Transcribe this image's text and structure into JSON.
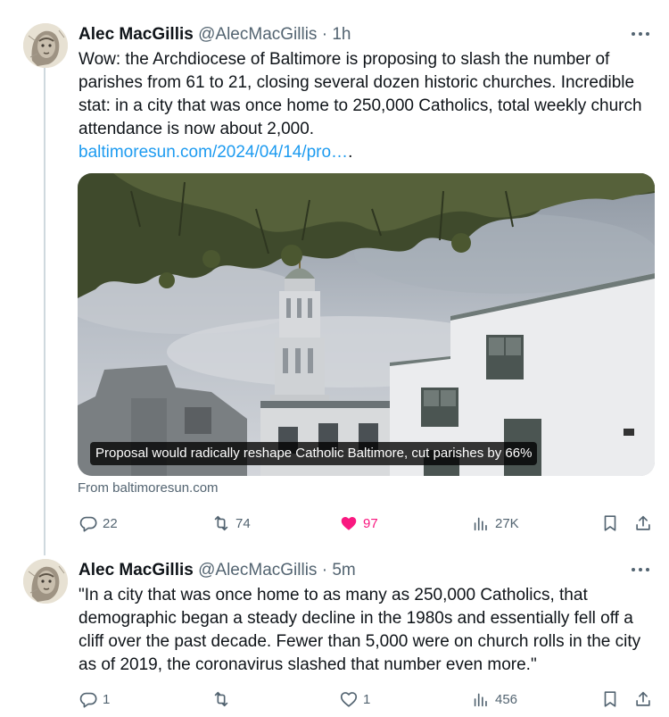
{
  "tweets": [
    {
      "name": "Alec MacGillis",
      "handle": "@AlecMacGillis",
      "separator": "·",
      "time": "1h",
      "text": "Wow: the Archdiocese of Baltimore is proposing to slash the number of parishes from 61 to 21, closing several dozen historic churches. Incredible stat: in a city that was once home to 250,000 Catholics, total weekly church attendance is now about 2,000.",
      "link": "baltimoresun.com/2024/04/14/pro…",
      "link_suffix": ".",
      "card": {
        "caption": "Proposal would radically reshape Catholic Baltimore, cut parishes by 66%",
        "source": "From baltimoresun.com"
      },
      "stats": {
        "replies": "22",
        "reposts": "74",
        "likes": "97",
        "views": "27K"
      },
      "liked": true
    },
    {
      "name": "Alec MacGillis",
      "handle": "@AlecMacGillis",
      "separator": "·",
      "time": "5m",
      "text": "\"In a city that was once home to as many as 250,000 Catholics, that demographic began a steady decline in the 1980s and essentially fell off a cliff over the past decade. Fewer than 5,000 were on church rolls in the city as of 2019, the coronavirus slashed that number even more.\"",
      "stats": {
        "replies": "1",
        "reposts": "",
        "likes": "1",
        "views": "456"
      },
      "liked": false
    }
  ],
  "colors": {
    "text": "#0f1419",
    "secondary": "#536471",
    "link": "#1d9bf0",
    "like": "#f91880",
    "thread_line": "#cfd9de"
  },
  "icons": [
    "reply-icon",
    "repost-icon",
    "heart-icon",
    "views-icon",
    "bookmark-icon",
    "share-icon",
    "more-icon"
  ]
}
